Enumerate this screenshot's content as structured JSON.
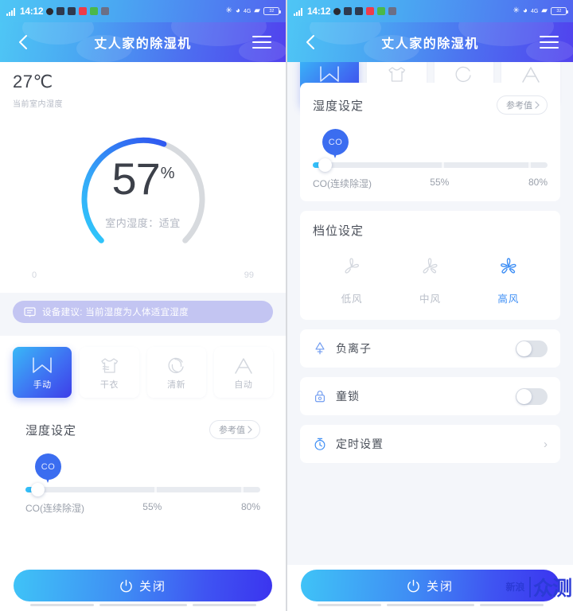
{
  "status_bar": {
    "time": "14:12",
    "signal_icon": "signal-bars-icon",
    "right_icons": [
      "bluetooth-icon",
      "alarm-icon",
      "4g-icon",
      "wifi-icon",
      "battery-icon"
    ],
    "battery_level": "32",
    "network": "4G"
  },
  "header": {
    "title": "丈人家的除湿机",
    "back_icon": "back-chevron-icon",
    "menu_icon": "hamburger-menu-icon"
  },
  "reading": {
    "temperature": "27℃",
    "temperature_caption": "当前室内湿度",
    "humidity_value": "57",
    "humidity_unit": "%",
    "humidity_status": "室内湿度：适宜",
    "gauge_min": "0",
    "gauge_max": "99"
  },
  "suggestion": {
    "icon": "message-bubble-icon",
    "text": "设备建议: 当前湿度为人体适宜湿度"
  },
  "modes": {
    "items": [
      {
        "label": "手动",
        "icon": "letter-m-icon",
        "active": true
      },
      {
        "label": "干衣",
        "icon": "tshirt-icon",
        "active": false
      },
      {
        "label": "清新",
        "icon": "refresh-circle-icon",
        "active": false
      },
      {
        "label": "自动",
        "icon": "letter-a-icon",
        "active": false
      }
    ]
  },
  "humidity_setting": {
    "title": "湿度设定",
    "reference_label": "参考值",
    "reference_icon": "chevron-right-icon",
    "pin_label": "CO",
    "labels": [
      "CO(连续除湿)",
      "55%",
      "80%"
    ],
    "slider_value": 0
  },
  "fan_setting": {
    "title": "档位设定",
    "items": [
      {
        "label": "低风",
        "icon": "fan-low-icon",
        "active": false
      },
      {
        "label": "中风",
        "icon": "fan-medium-icon",
        "active": false
      },
      {
        "label": "高风",
        "icon": "fan-high-icon",
        "active": true
      }
    ]
  },
  "rows": [
    {
      "label": "负离子",
      "icon": "anion-icon",
      "control": "toggle",
      "on": false
    },
    {
      "label": "童锁",
      "icon": "lock-icon",
      "control": "toggle",
      "on": false
    },
    {
      "label": "定时设置",
      "icon": "timer-icon",
      "control": "chevron"
    }
  ],
  "bottom": {
    "power_label": "关闭",
    "power_icon": "power-icon"
  },
  "watermark": {
    "small": "新浪",
    "big": "众测"
  },
  "colors": {
    "accent_cyan": "#3fc3f7",
    "accent_blue": "#3b34ef",
    "header_start": "#4ec6f5",
    "header_end": "#5142ee",
    "suggestion_bg": "#c3c5f2",
    "page_bg": "#f4f6fa",
    "text_dark": "#4a4f59",
    "text_muted": "#b9bec8"
  }
}
